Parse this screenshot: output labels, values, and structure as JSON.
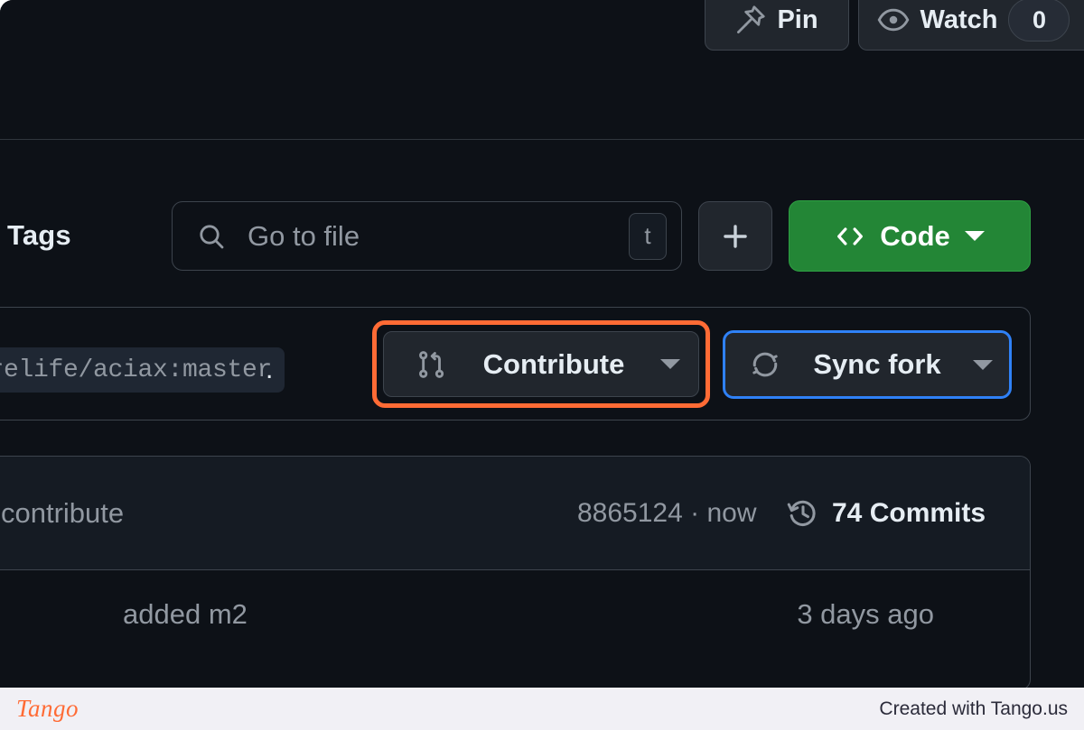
{
  "header": {
    "pin": {
      "label": "Pin",
      "icon": "pin-icon"
    },
    "watch": {
      "label": "Watch",
      "count": "0",
      "icon": "eye-icon"
    }
  },
  "filebar": {
    "tags_label": "Tags",
    "search": {
      "placeholder": "Go to file",
      "icon": "search-icon",
      "kbd": "t"
    },
    "add_button_icon": "plus-icon",
    "code_button": {
      "label": "Code",
      "icon": "code-brackets-icon"
    }
  },
  "fork_banner": {
    "branch_ref": "arelife/aciax:master",
    "separator": ".",
    "contribute": {
      "label": "Contribute",
      "icon": "git-pull-request-icon",
      "highlight_color": "#ff6b35"
    },
    "sync_fork": {
      "label": "Sync fork",
      "icon": "sync-icon",
      "focus_color": "#2f81f7"
    }
  },
  "commits": {
    "message": "contribute",
    "meta": "8865124 · now",
    "count_label": "74 Commits",
    "history_icon": "history-clock-icon"
  },
  "file_row": {
    "commit_message": "added m2",
    "time": "3 days ago"
  },
  "footer": {
    "logo": "Tango",
    "credit": "Created with Tango.us"
  },
  "colors": {
    "background": "#0d1117",
    "surface": "#151b23",
    "border": "#3d444d",
    "text": "#e6edf3",
    "muted": "#9198a1",
    "green": "#238636",
    "orange": "#ff6b35",
    "blue": "#2f81f7"
  }
}
